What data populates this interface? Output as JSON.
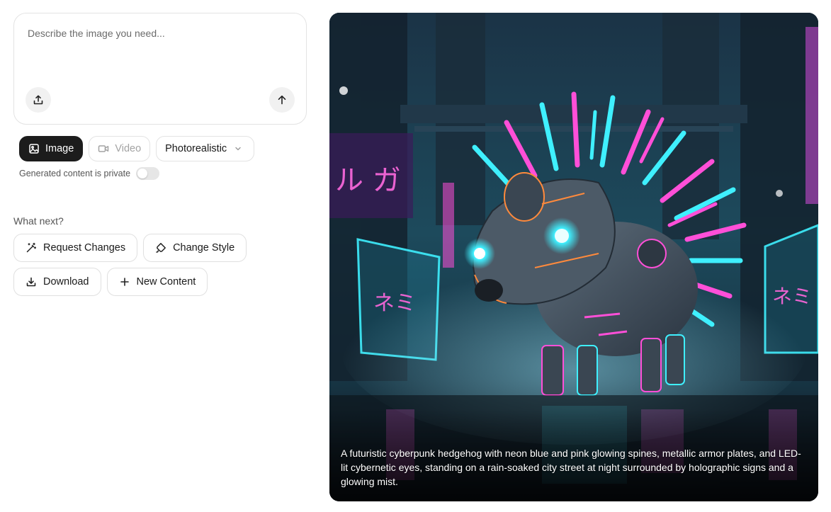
{
  "prompt": {
    "placeholder": "Describe the image you need..."
  },
  "modes": {
    "image_label": "Image",
    "video_label": "Video",
    "style_value": "Photorealistic"
  },
  "privacy": {
    "label": "Generated content is private",
    "enabled": false
  },
  "next": {
    "heading": "What next?",
    "request_changes": "Request Changes",
    "change_style": "Change Style",
    "download": "Download",
    "new_content": "New Content"
  },
  "result": {
    "caption": "A futuristic cyberpunk hedgehog with neon blue and pink glowing spines, metallic armor plates, and LED-lit cybernetic eyes, standing on a rain-soaked city street at night surrounded by holographic signs and a glowing mist."
  },
  "colors": {
    "accent_dark": "#1c1c1c",
    "neon_cyan": "#3ff0ff",
    "neon_pink": "#ff4fd8"
  },
  "icons": [
    "upload-icon",
    "arrow-up-icon",
    "image-icon",
    "video-icon",
    "chevron-down-icon",
    "magic-wand-icon",
    "style-icon",
    "download-icon",
    "plus-icon"
  ]
}
